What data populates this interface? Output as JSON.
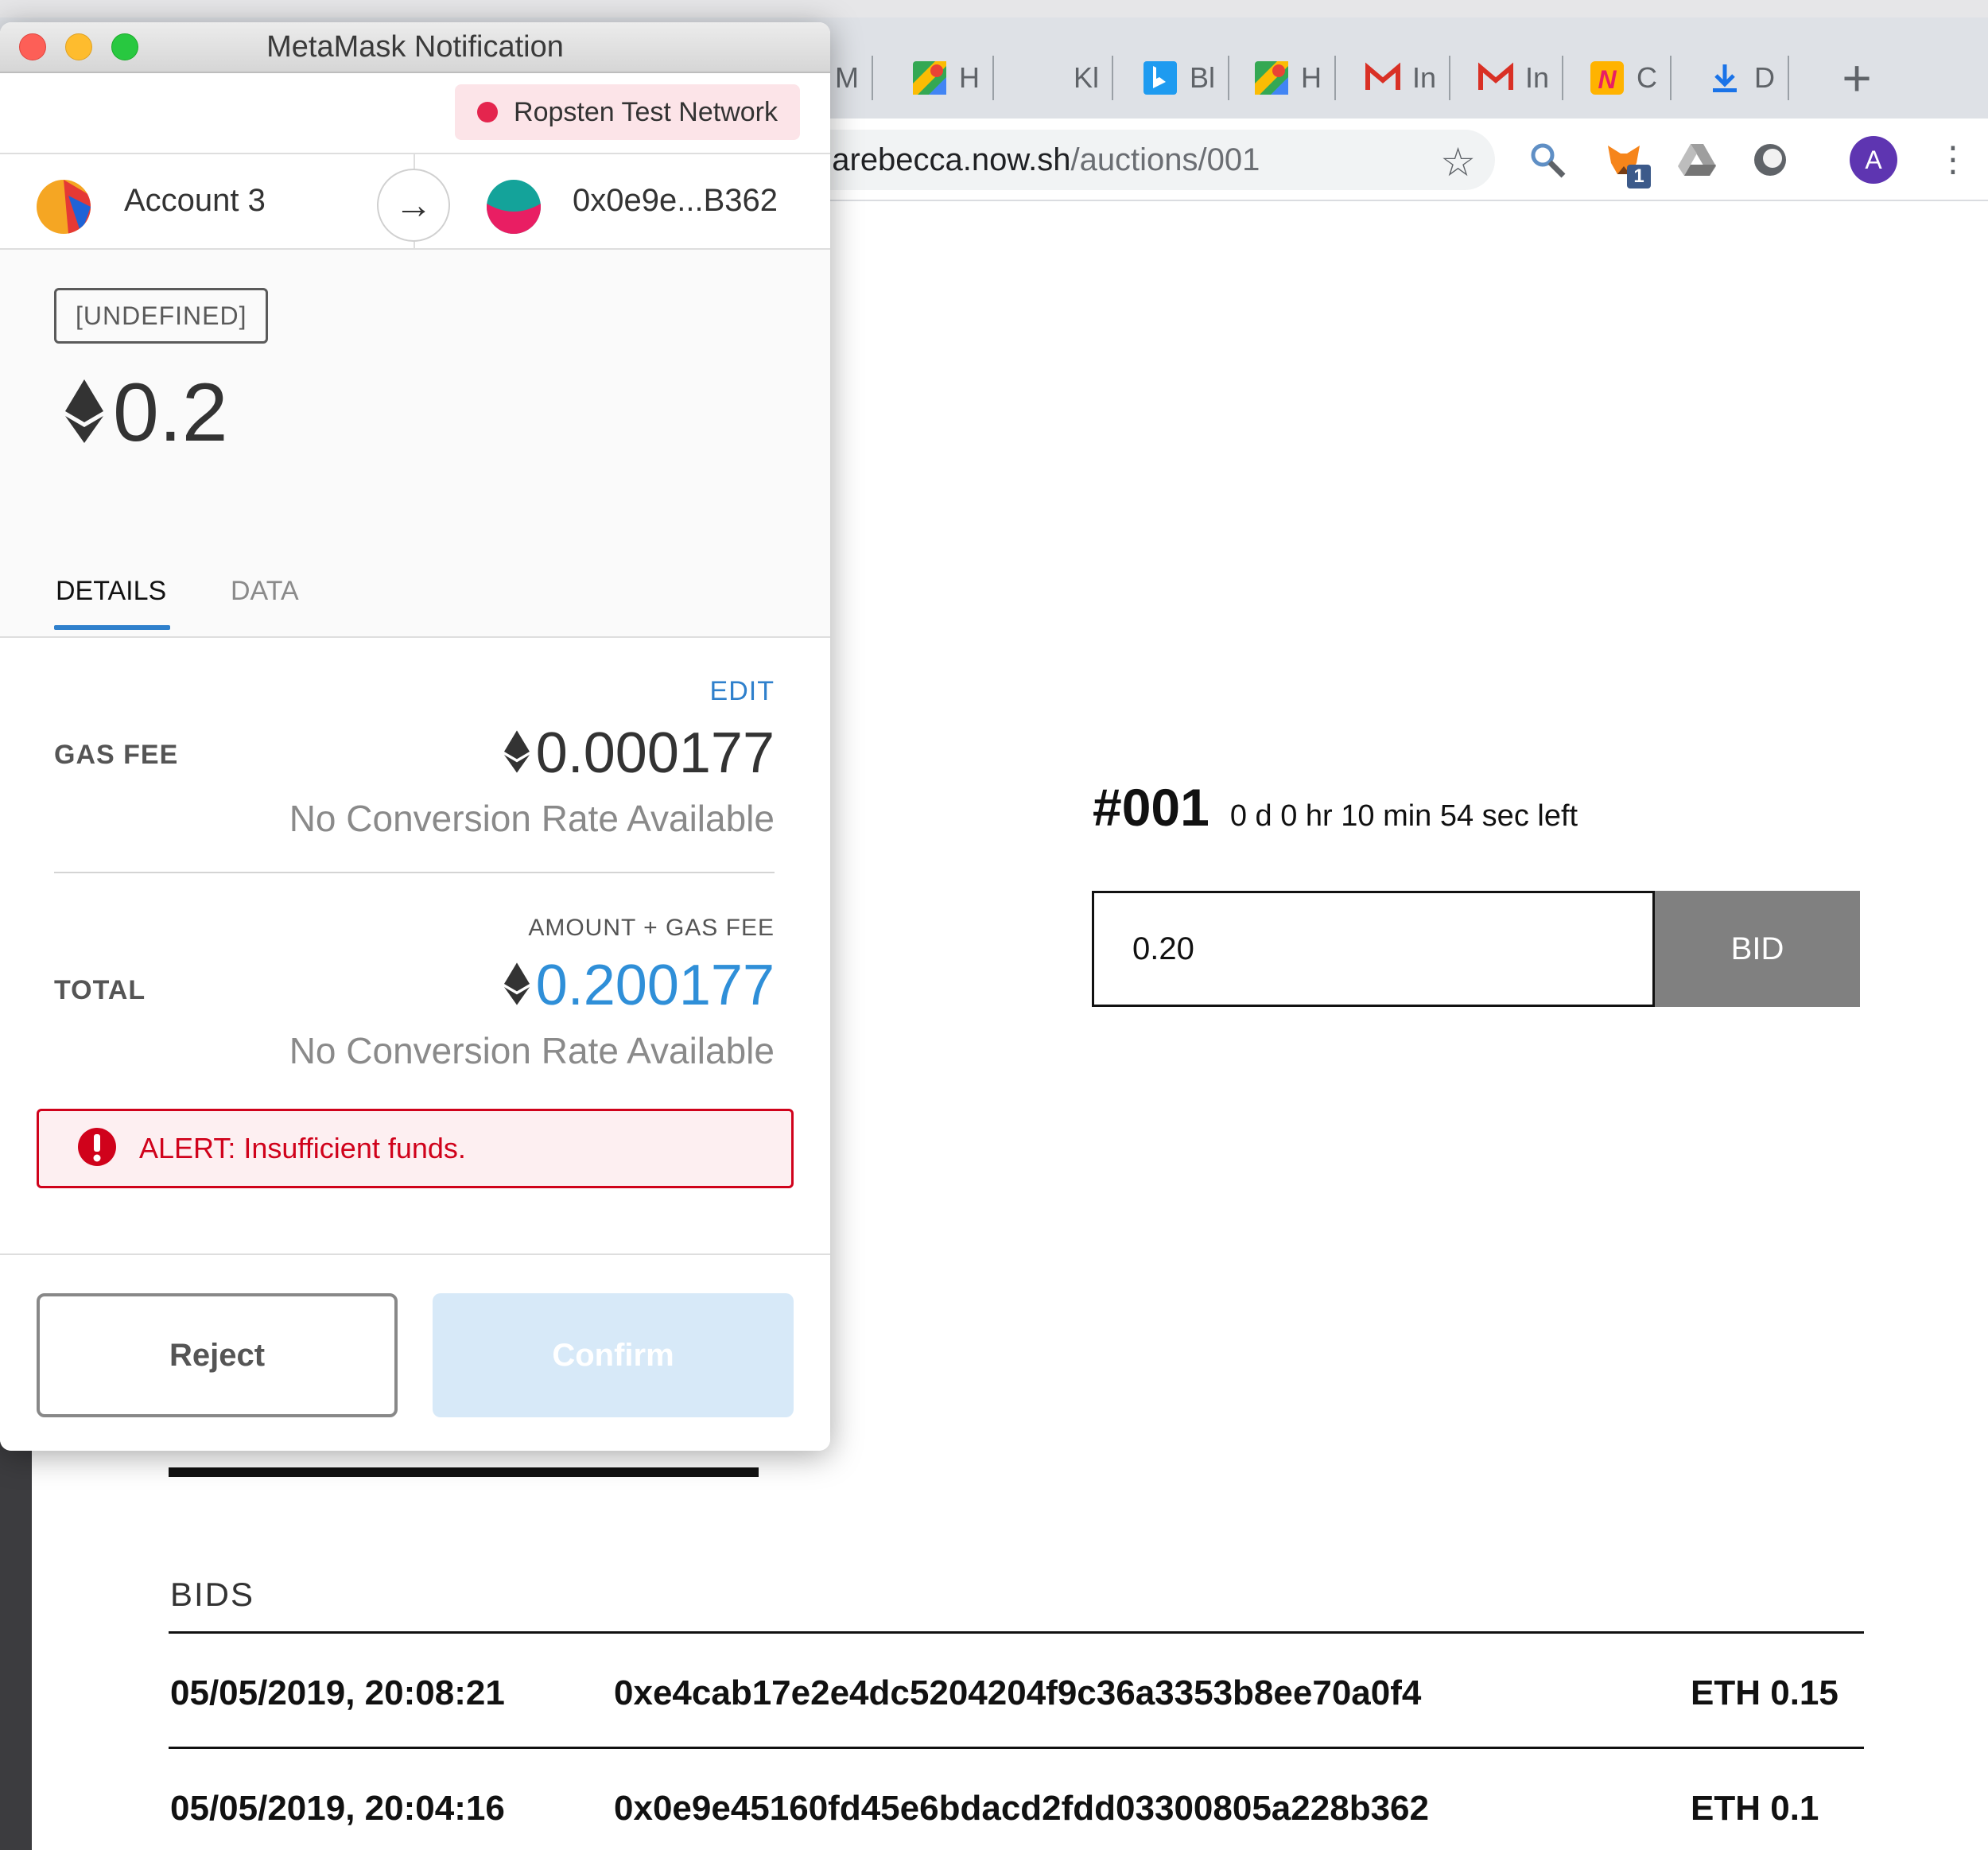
{
  "browser": {
    "tabs": [
      {
        "letter": "M",
        "icon": "maps-icon"
      },
      {
        "letter": "H",
        "icon": "maps-icon"
      },
      {
        "letter": "Kl",
        "icon": "blank-icon"
      },
      {
        "letter": "Bl",
        "icon": "bing-icon"
      },
      {
        "letter": "H",
        "icon": "maps-icon"
      },
      {
        "letter": "In",
        "icon": "gmail-icon"
      },
      {
        "letter": "In",
        "icon": "gmail-icon"
      },
      {
        "letter": "C",
        "icon": "n-icon"
      },
      {
        "letter": "D",
        "icon": "download-icon"
      }
    ],
    "url_host": "narebecca.now.sh",
    "url_path": "/auctions/001",
    "extension_badge": "1",
    "avatar_letter": "A",
    "colors": {
      "tabstrip": "#dee1e6",
      "avatar": "#5e35b1",
      "badge": "#3c5a8a"
    }
  },
  "auction": {
    "number": "#001",
    "time_left": "0 d 0 hr 10 min 54 sec left",
    "bid_value": "0.20",
    "bid_button": "BID",
    "bids_label": "BIDS",
    "bids": [
      {
        "time": "05/05/2019, 20:08:21",
        "address": "0xe4cab17e2e4dc5204204f9c36a3353b8ee70a0f4",
        "amount": "ETH 0.15"
      },
      {
        "time": "05/05/2019, 20:04:16",
        "address": "0x0e9e45160fd45e6bdacd2fdd03300805a228b362",
        "amount": "ETH 0.1"
      }
    ]
  },
  "metamask": {
    "window_title": "MetaMask Notification",
    "network": "Ropsten Test Network",
    "from_account": "Account 3",
    "to_address": "0x0e9e...B362",
    "method_tag": "[UNDEFINED]",
    "amount": "0.2",
    "tabs": {
      "details": "DETAILS",
      "data": "DATA"
    },
    "edit_label": "EDIT",
    "gas_fee_label": "GAS FEE",
    "gas_fee_value": "0.000177",
    "no_conversion": "No Conversion Rate Available",
    "amount_plus_gas_label": "AMOUNT + GAS FEE",
    "total_label": "TOTAL",
    "total_value": "0.200177",
    "alert": "ALERT: Insufficient funds.",
    "reject_label": "Reject",
    "confirm_label": "Confirm",
    "colors": {
      "accent": "#2f80cc",
      "total": "#2f8fd8",
      "alert": "#d0021b",
      "network_dot": "#e4254e",
      "confirm_disabled": "#d7e9f8"
    }
  }
}
